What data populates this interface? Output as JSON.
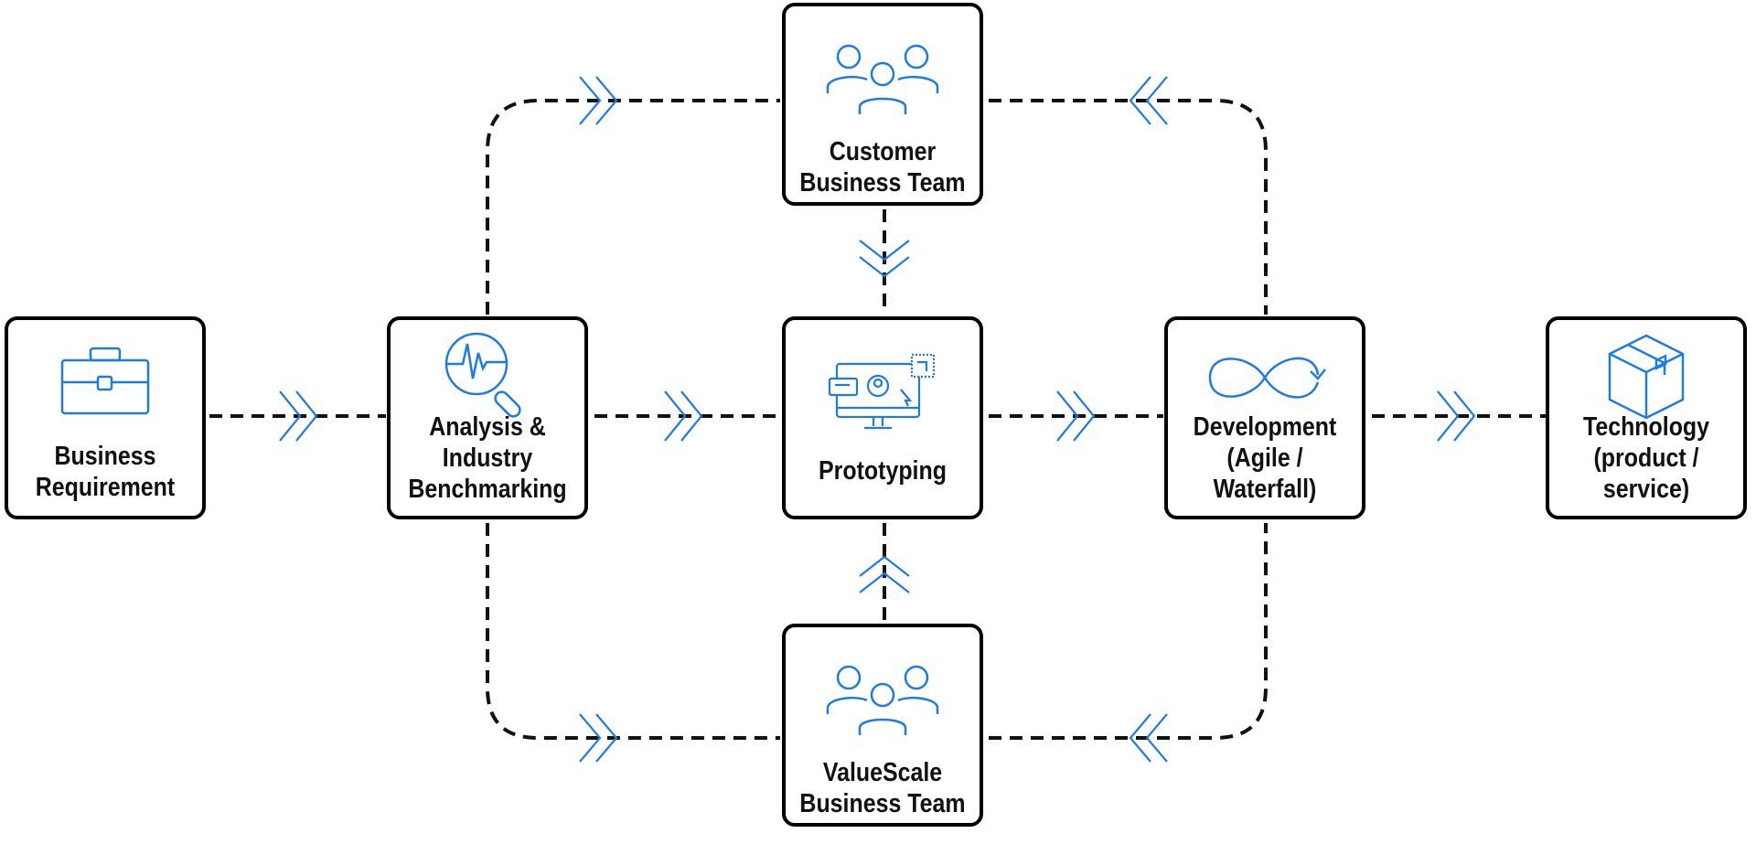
{
  "accent_color": "#1e7be6",
  "nodes": {
    "business_requirement": {
      "label": "Business\nRequirement",
      "icon": "briefcase-icon"
    },
    "analysis": {
      "label": "Analysis &\nIndustry\nBenchmarking",
      "icon": "magnifier-pulse-icon"
    },
    "prototyping": {
      "label": "Prototyping",
      "icon": "monitor-prototype-icon"
    },
    "development": {
      "label": "Development\n(Agile /\nWaterfall)",
      "icon": "infinity-loop-icon"
    },
    "technology": {
      "label": "Technology\n(product /\nservice)",
      "icon": "package-box-icon"
    },
    "customer_team": {
      "label": "Customer\nBusiness Team",
      "icon": "team-icon"
    },
    "valuescale_team": {
      "label": "ValueScale\nBusiness Team",
      "icon": "team-icon"
    }
  }
}
